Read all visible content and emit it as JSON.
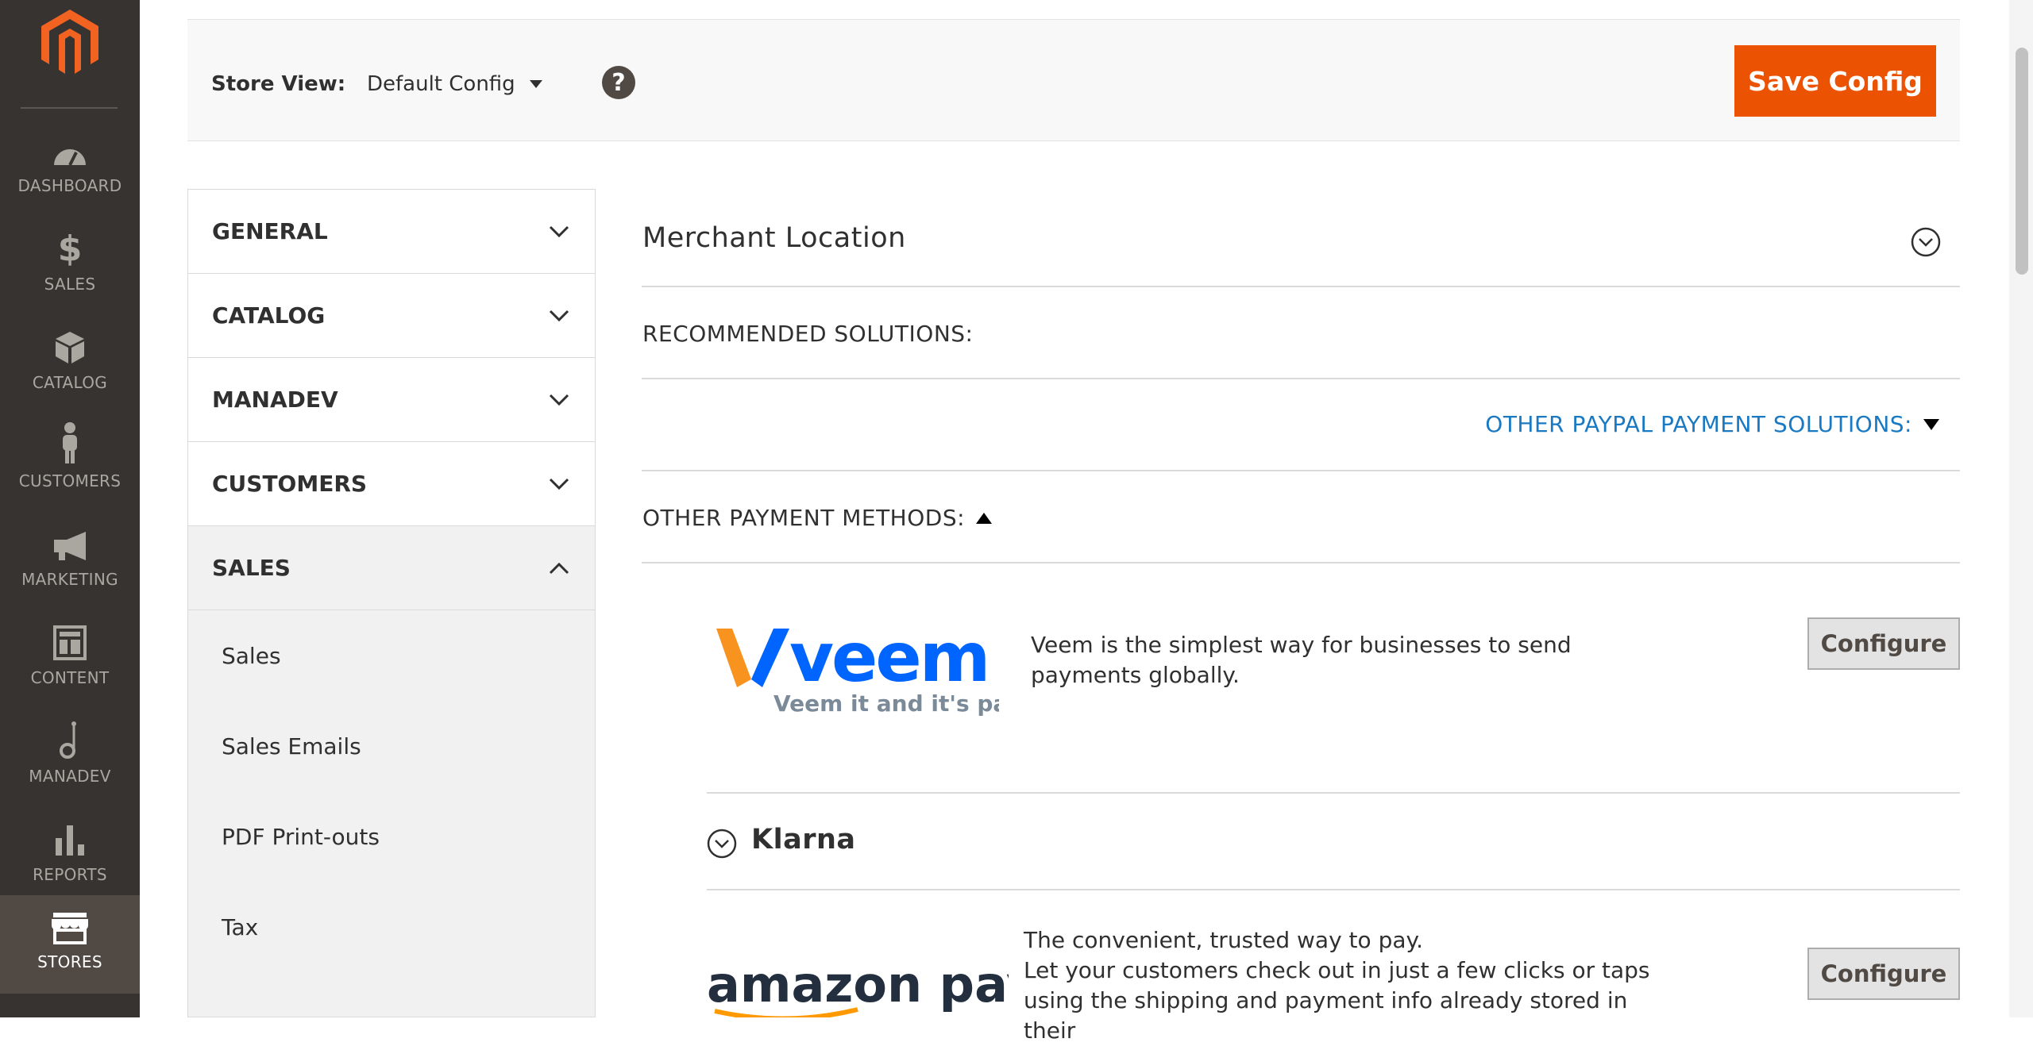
{
  "nav": {
    "items": [
      {
        "label": "DASHBOARD",
        "icon": "dashboard-icon"
      },
      {
        "label": "SALES",
        "icon": "dollar-icon"
      },
      {
        "label": "CATALOG",
        "icon": "box-icon"
      },
      {
        "label": "CUSTOMERS",
        "icon": "person-icon"
      },
      {
        "label": "MARKETING",
        "icon": "megaphone-icon"
      },
      {
        "label": "CONTENT",
        "icon": "layout-icon"
      },
      {
        "label": "MANADEV",
        "icon": "note-icon"
      },
      {
        "label": "REPORTS",
        "icon": "bar-chart-icon"
      },
      {
        "label": "STORES",
        "icon": "storefront-icon",
        "active": true
      }
    ]
  },
  "header": {
    "store_view_label": "Store View:",
    "store_view_value": "Default Config",
    "help": "?",
    "save_label": "Save Config"
  },
  "tabs": {
    "sections": [
      {
        "label": "GENERAL",
        "state": "collapsed"
      },
      {
        "label": "CATALOG",
        "state": "collapsed"
      },
      {
        "label": "MANADEV",
        "state": "collapsed"
      },
      {
        "label": "CUSTOMERS",
        "state": "collapsed"
      },
      {
        "label": "SALES",
        "state": "expanded"
      }
    ],
    "sales_items": [
      "Sales",
      "Sales Emails",
      "PDF Print-outs",
      "Tax"
    ]
  },
  "main": {
    "merchant_location": "Merchant Location",
    "recommended": "RECOMMENDED SOLUTIONS:",
    "other_paypal": "OTHER PAYPAL PAYMENT SOLUTIONS:",
    "other_methods": "OTHER PAYMENT METHODS:",
    "veem": {
      "logo_text": "veem",
      "tagline": "Veem it and it's paid",
      "description": "Veem is the simplest way for businesses to send payments globally.",
      "button": "Configure"
    },
    "klarna": {
      "title": "Klarna"
    },
    "amazon": {
      "logo_text": "amazon pay",
      "line1": "The convenient, trusted way to pay.",
      "line2": "Let your customers check out in just a few clicks or taps",
      "line3": "using the shipping and payment info already stored in their",
      "button": "Configure"
    }
  },
  "colors": {
    "nav_bg": "#373330",
    "accent": "#eb5202",
    "link": "#1979c3",
    "veem_orange": "#f7931e",
    "veem_blue": "#0064ff"
  }
}
